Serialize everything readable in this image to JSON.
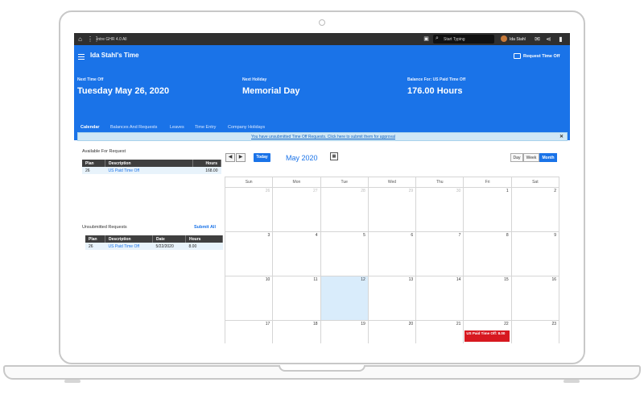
{
  "system_bar": {
    "app_name": "Intre GHR 4.0 All",
    "search_placeholder": "Start Typing",
    "user_name": "Ida Stahl"
  },
  "header": {
    "title": "Ida Stahl's Time",
    "request_button": "Request Time Off",
    "kpis": [
      {
        "label": "Next Time Off",
        "value": "Tuesday May 26, 2020"
      },
      {
        "label": "Next Holiday",
        "value": "Memorial Day"
      },
      {
        "label": "Balance For: US Paid Time Off",
        "value": "176.00 Hours"
      }
    ]
  },
  "tabs": [
    "Calendar",
    "Balances And Requests",
    "Leaves",
    "Time Entry",
    "Company Holidays"
  ],
  "banner": "You have unsubmitted Time Off Requests. Click here to submit them for approval",
  "available": {
    "title": "Available For Request",
    "headers": [
      "Plan",
      "Description",
      "Hours"
    ],
    "rows": [
      {
        "plan": "26",
        "description": "US Paid Time Off",
        "hours": "168.00"
      }
    ]
  },
  "unsubmitted": {
    "title": "Unsubmitted Requests",
    "submit_all": "Submit All",
    "headers": [
      "Plan",
      "Description",
      "Date",
      "Hours"
    ],
    "rows": [
      {
        "plan": "26",
        "description": "US Paid Time Off",
        "date": "5/22/2020",
        "hours": "8.00"
      }
    ]
  },
  "calendar": {
    "today_label": "Today",
    "month": "May 2020",
    "views": [
      "Day",
      "Week",
      "Month"
    ],
    "active_view": "Month",
    "weekdays": [
      "Sun",
      "Mon",
      "Tue",
      "Wed",
      "Thu",
      "Fri",
      "Sat"
    ],
    "weeks": [
      [
        "26",
        "27",
        "28",
        "29",
        "30",
        "1",
        "2"
      ],
      [
        "3",
        "4",
        "5",
        "6",
        "7",
        "8",
        "9"
      ],
      [
        "10",
        "11",
        "12",
        "13",
        "14",
        "15",
        "16"
      ],
      [
        "17",
        "18",
        "19",
        "20",
        "21",
        "22",
        "23"
      ]
    ],
    "today_day": "12",
    "event": {
      "day": "22",
      "label": "US Paid Time Off: 8.00"
    }
  }
}
